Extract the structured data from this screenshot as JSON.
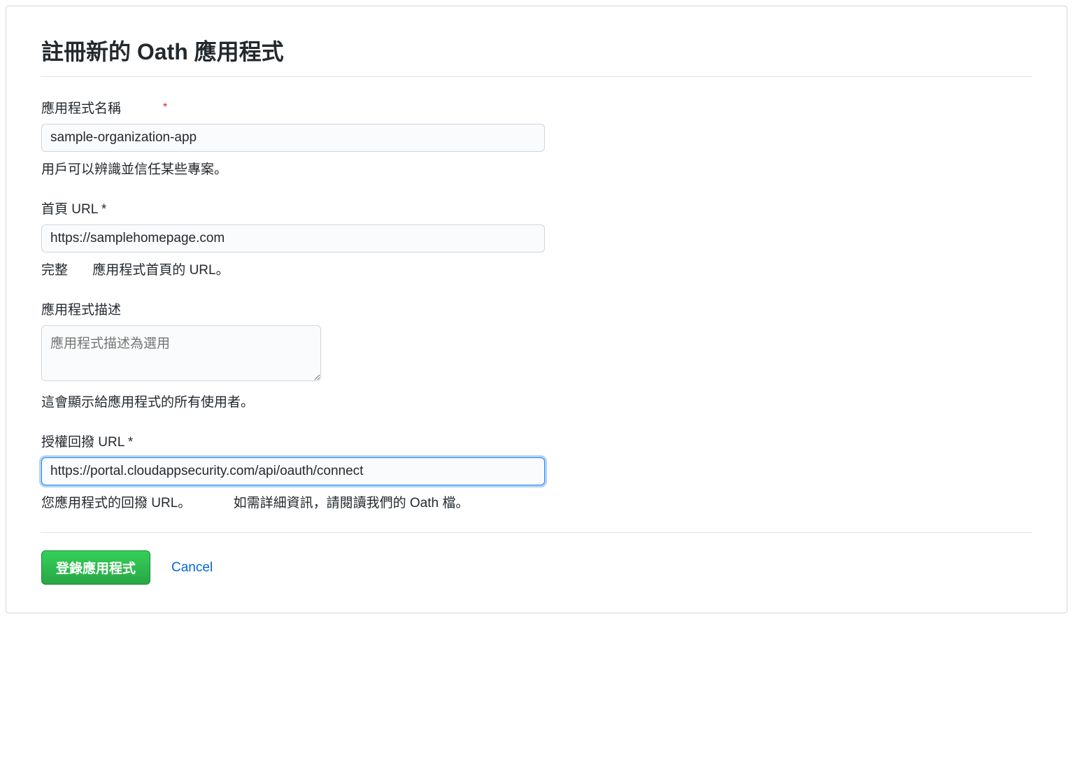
{
  "page": {
    "title": "註冊新的 Oath 應用程式"
  },
  "form": {
    "app_name": {
      "label": "應用程式名稱",
      "value": "sample-organization-app",
      "help": "用戶可以辨識並信任某些專案。"
    },
    "homepage_url": {
      "label": "首頁 URL *",
      "value": "https://samplehomepage.com",
      "help_part1": "完整",
      "help_part2": "應用程式首頁的 URL。"
    },
    "description": {
      "label": "應用程式描述",
      "placeholder": "應用程式描述為選用",
      "help": "這會顯示給應用程式的所有使用者。"
    },
    "callback_url": {
      "label": "授權回撥 URL *",
      "value": "https://portal.cloudappsecurity.com/api/oauth/connect",
      "help_part1": "您應用程式的回撥 URL。",
      "help_part2": "如需詳細資訊，請閱讀我們的 Oath 檔。"
    }
  },
  "buttons": {
    "submit": "登錄應用程式",
    "cancel": "Cancel"
  },
  "required_mark": "*"
}
